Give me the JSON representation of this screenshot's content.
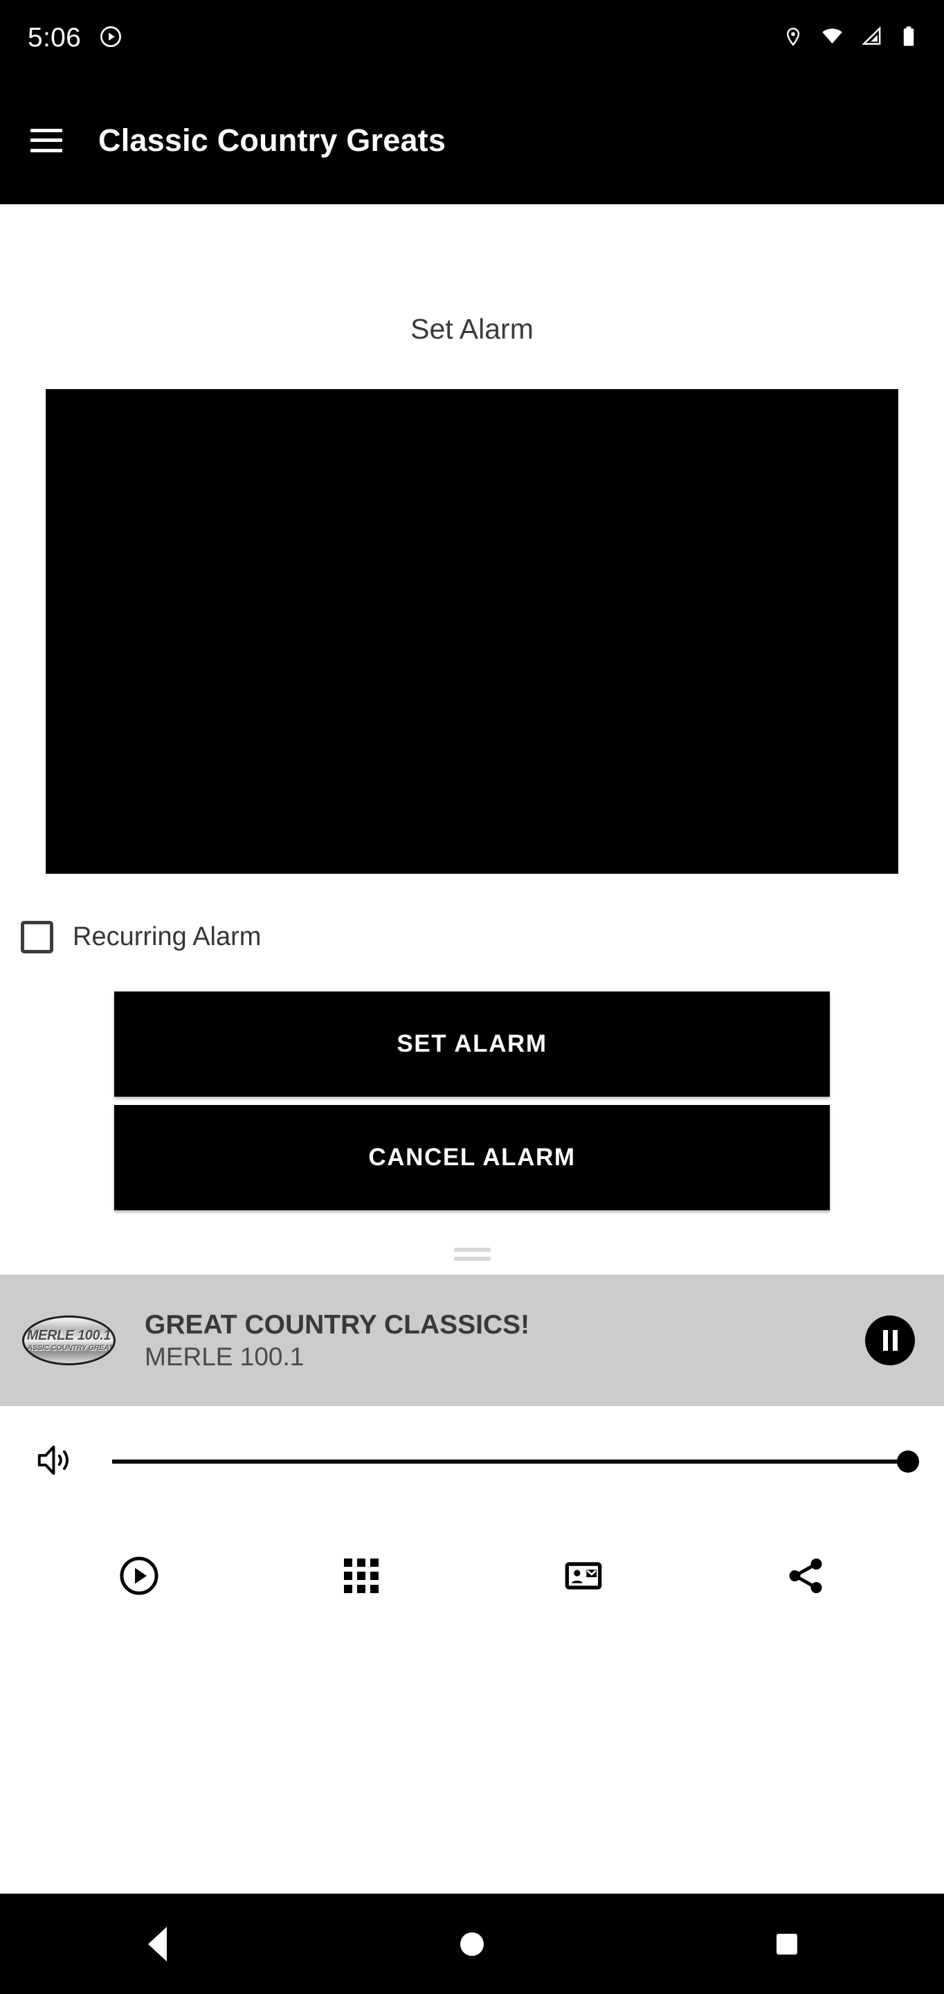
{
  "status_bar": {
    "time": "5:06",
    "icons": [
      "play-circle-icon",
      "location-pin-icon",
      "wifi-icon",
      "cell-signal-icon",
      "battery-icon"
    ]
  },
  "app_bar": {
    "menu_icon": "hamburger-menu-icon",
    "title": "Classic Country Greats"
  },
  "main": {
    "section_title": "Set Alarm",
    "time_picker_placeholder": "",
    "recurring": {
      "label": "Recurring Alarm",
      "checked": false
    },
    "buttons": {
      "set_alarm": "SET ALARM",
      "cancel_alarm": "CANCEL ALARM"
    }
  },
  "player": {
    "logo_line1": "MERLE 100.1",
    "logo_line2": "CLASSIC COUNTRY GREATS!",
    "title": "GREAT COUNTRY CLASSICS!",
    "subtitle": "MERLE 100.1",
    "transport_icon": "pause-icon"
  },
  "volume": {
    "icon": "volume-up-icon",
    "level": 100
  },
  "actions": [
    {
      "name": "play-circle-icon"
    },
    {
      "name": "grid-apps-icon"
    },
    {
      "name": "contact-card-icon"
    },
    {
      "name": "share-icon"
    }
  ],
  "nav_bar": {
    "back": "back-triangle-icon",
    "home": "home-circle-icon",
    "recents": "recents-square-icon"
  },
  "colors": {
    "app_bar_bg": "#000000",
    "page_bg": "#ffffff",
    "player_bg": "#cccccc",
    "button_bg": "#000000",
    "button_text": "#ffffff",
    "text_primary": "#393939"
  }
}
